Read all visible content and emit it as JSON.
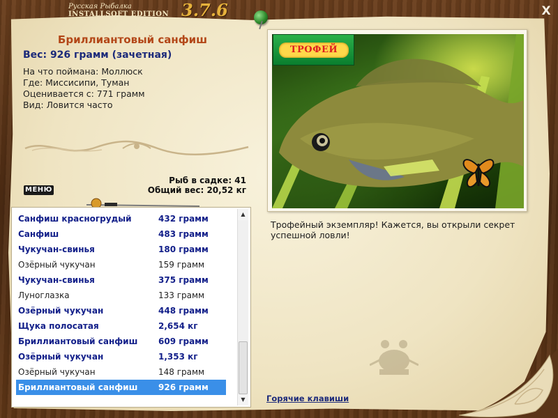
{
  "header": {
    "line1": "Русская Рыбалка",
    "line2": "INSTALLSOFT EDITION",
    "version": "3.7.6",
    "close_label": "X"
  },
  "fish": {
    "name": "Бриллиантовый санфиш",
    "weight": "Вес: 926 грамм (зачетная)",
    "bait": "На что поймана: Моллюск",
    "location": "Где: Миссисипи, Туман",
    "valued": "Оценивается с: 771 грамм",
    "kind": "Вид: Ловится часто"
  },
  "stats": {
    "count": "Рыб в садке: 41",
    "total": "Общий вес: 20,52 кг"
  },
  "menu_label": "МЕНЮ",
  "catch_list": [
    {
      "name": "Санфиш красногрудый",
      "weight": "432 грамм",
      "trophy": true,
      "selected": false
    },
    {
      "name": "Санфиш",
      "weight": "483 грамм",
      "trophy": true,
      "selected": false
    },
    {
      "name": "Чукучан-свинья",
      "weight": "180 грамм",
      "trophy": true,
      "selected": false
    },
    {
      "name": "Озёрный чукучан",
      "weight": "159 грамм",
      "trophy": false,
      "selected": false
    },
    {
      "name": "Чукучан-свинья",
      "weight": "375 грамм",
      "trophy": true,
      "selected": false
    },
    {
      "name": "Луноглазка",
      "weight": "133 грамм",
      "trophy": false,
      "selected": false
    },
    {
      "name": "Озёрный чукучан",
      "weight": "448 грамм",
      "trophy": true,
      "selected": false
    },
    {
      "name": "Щука полосатая",
      "weight": "2,654 кг",
      "trophy": true,
      "selected": false
    },
    {
      "name": "Бриллиантовый санфиш",
      "weight": "609 грамм",
      "trophy": true,
      "selected": false
    },
    {
      "name": "Озёрный чукучан",
      "weight": "1,353 кг",
      "trophy": true,
      "selected": false
    },
    {
      "name": "Озёрный чукучан",
      "weight": "148 грамм",
      "trophy": false,
      "selected": false
    },
    {
      "name": "Бриллиантовый санфиш",
      "weight": "926 грамм",
      "trophy": true,
      "selected": true
    }
  ],
  "trophy_badge": "ТРОФЕЙ",
  "trophy_text": "Трофейный экземпляр! Кажется, вы открыли секрет успешной ловли!",
  "hotkeys_label": "Горячие клавиши",
  "colors": {
    "trophy_text": "#13208a",
    "normal_text": "#222222",
    "selection": "#3a8fe8",
    "fish_name": "#b34718"
  }
}
